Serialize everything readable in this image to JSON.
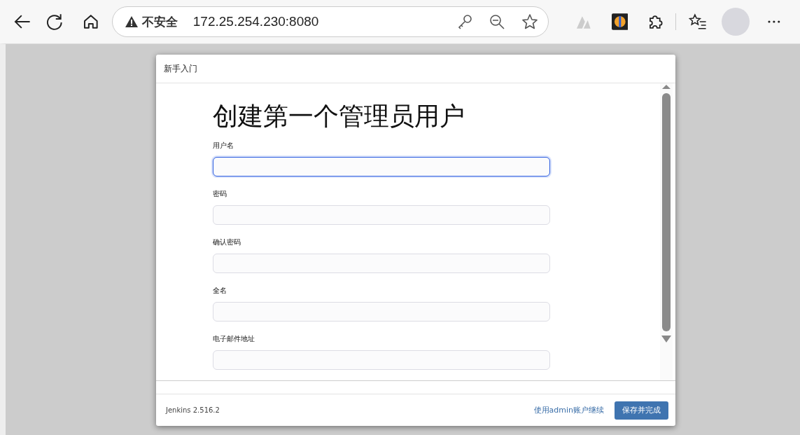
{
  "browser": {
    "security_label": "不安全",
    "url": "172.25.254.230:8080"
  },
  "dialog": {
    "title": "新手入门",
    "heading": "创建第一个管理员用户",
    "fields": [
      {
        "label": "用户名",
        "focused": true
      },
      {
        "label": "密码",
        "focused": false
      },
      {
        "label": "确认密码",
        "focused": false
      },
      {
        "label": "全名",
        "focused": false
      },
      {
        "label": "电子邮件地址",
        "focused": false
      }
    ],
    "footer": {
      "version": "Jenkins 2.516.2",
      "link": "使用admin账户继续",
      "button": "保存并完成"
    }
  }
}
